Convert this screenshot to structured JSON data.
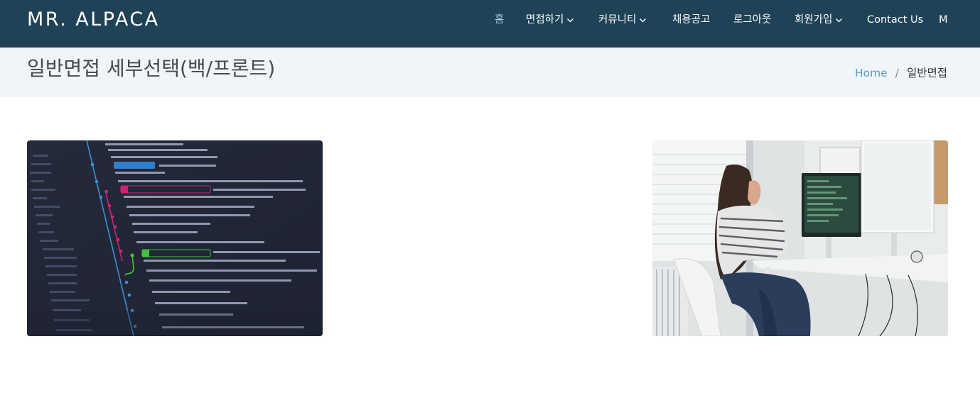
{
  "brand": "MR. ALPACA",
  "nav": {
    "items": [
      {
        "label": "홈",
        "active": true,
        "dropdown": false
      },
      {
        "label": "면접하기",
        "active": false,
        "dropdown": true
      },
      {
        "label": "커뮤니티",
        "active": false,
        "dropdown": true
      },
      {
        "label": "채용공고",
        "active": false,
        "dropdown": false
      },
      {
        "label": "로그아웃",
        "active": false,
        "dropdown": false
      },
      {
        "label": "회원가입",
        "active": false,
        "dropdown": true
      },
      {
        "label": "Contact Us",
        "active": false,
        "dropdown": false
      },
      {
        "label": "M",
        "active": false,
        "dropdown": false
      }
    ]
  },
  "page": {
    "title": "일반면접 세부선택(백/프론트)",
    "breadcrumb": {
      "home": "Home",
      "separator": "/",
      "current": "일반면접"
    }
  },
  "cards": {
    "left": {
      "image": "code-git-log-image"
    },
    "right": {
      "image": "woman-at-desk-computer-image"
    }
  },
  "colors": {
    "navbar_bg": "#1f4256",
    "titlebar_bg": "#eff5f8",
    "active_nav": "#a8d4ee",
    "breadcrumb_link": "#5b9bc7"
  }
}
